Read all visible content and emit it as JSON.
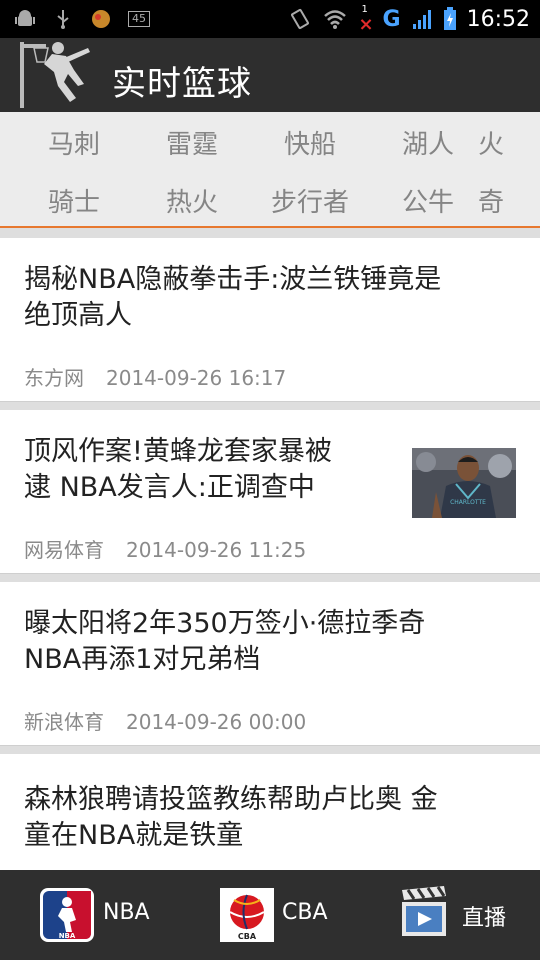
{
  "status_bar": {
    "time": "16:52",
    "network": "G",
    "icons": [
      "android-debug-icon",
      "usb-icon",
      "app-icon",
      "battery-level-icon",
      "vibrate-icon",
      "wifi-icon",
      "no-signal-icon",
      "signal-icon",
      "battery-icon"
    ],
    "battery_text": "45",
    "sim_badge": "1"
  },
  "app_bar": {
    "title": "实时篮球",
    "logo": "basketball-player-logo-icon"
  },
  "teams": {
    "row1": [
      "马刺",
      "雷霆",
      "快船",
      "湖人",
      "火"
    ],
    "row2": [
      "骑士",
      "热火",
      "步行者",
      "公牛",
      "奇"
    ]
  },
  "news": [
    {
      "title_line1": "揭秘NBA隐蔽拳击手:波兰铁锤竟是",
      "title_line2": "绝顶高人",
      "source": "东方网",
      "date": "2014-09-26 16:17",
      "has_thumb": false
    },
    {
      "title_line1": "顶风作案!黄蜂龙套家暴被",
      "title_line2": "逮 NBA发言人:正调查中",
      "source": "网易体育",
      "date": "2014-09-26 11:25",
      "has_thumb": true,
      "thumb_text": "CHARLOTTE"
    },
    {
      "title_line1": "曝太阳将2年350万签小·德拉季奇",
      "title_line2": "NBA再添1对兄弟档",
      "source": "新浪体育",
      "date": "2014-09-26 00:00",
      "has_thumb": false
    },
    {
      "title_line1": "森林狼聘请投篮教练帮助卢比奥 金",
      "title_line2": "童在NBA就是铁童",
      "source": "",
      "date": "",
      "has_thumb": false
    }
  ],
  "bottom_nav": [
    {
      "label": "NBA",
      "icon": "nba-logo-icon"
    },
    {
      "label": "CBA",
      "icon": "cba-logo-icon"
    },
    {
      "label": "直播",
      "icon": "clapperboard-icon"
    }
  ],
  "colors": {
    "accent": "#e7782f",
    "app_bar": "#2e2e2e",
    "tab_bg": "#ececec",
    "list_bg": "#dedede"
  }
}
